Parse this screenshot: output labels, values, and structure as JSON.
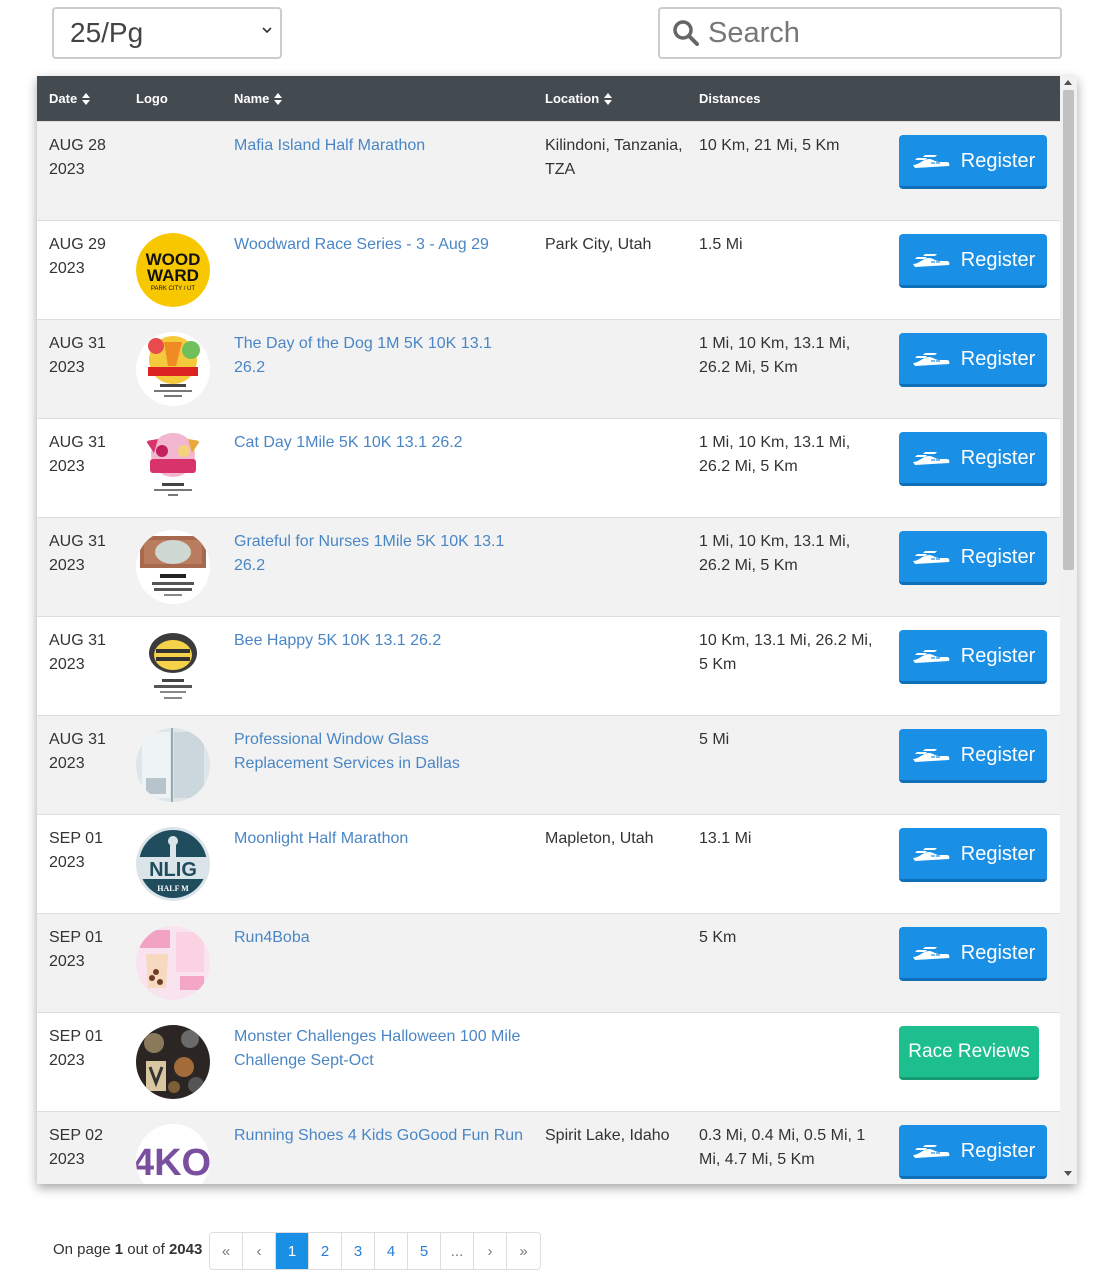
{
  "controls": {
    "per_page": "25/Pg",
    "search_placeholder": "Search"
  },
  "table": {
    "columns": [
      "Date",
      "Logo",
      "Name",
      "Location",
      "Distances"
    ],
    "rows": [
      {
        "date_md": "AUG 28",
        "date_y": "2023",
        "logo": "none",
        "name": "Mafia Island Half Marathon",
        "location": "Kilindoni, Tanzania, TZA",
        "distances": "10 Km, 21 Mi, 5 Km",
        "action": "Register"
      },
      {
        "date_md": "AUG 29",
        "date_y": "2023",
        "logo": "woodward",
        "logo_text_1": "WOOD",
        "logo_text_2": "WARD",
        "logo_text_3": "PARK CITY / UT",
        "name": "Woodward Race Series - 3 - Aug 29",
        "location": "Park City, Utah",
        "distances": "1.5 Mi",
        "action": "Register"
      },
      {
        "date_md": "AUG 31",
        "date_y": "2023",
        "logo": "dog-medal",
        "name": "The Day of the Dog 1M 5K 10K 13.1 26.2",
        "location": "",
        "distances": "1 Mi, 10 Km, 13.1 Mi, 26.2 Mi, 5 Km",
        "action": "Register"
      },
      {
        "date_md": "AUG 31",
        "date_y": "2023",
        "logo": "cat-medal",
        "name": "Cat Day 1Mile 5K 10K 13.1 26.2",
        "location": "",
        "distances": "1 Mi, 10 Km, 13.1 Mi, 26.2 Mi, 5 Km",
        "action": "Register"
      },
      {
        "date_md": "AUG 31",
        "date_y": "2023",
        "logo": "nurses-medal",
        "name": "Grateful for Nurses 1Mile 5K 10K 13.1 26.2",
        "location": "",
        "distances": "1 Mi, 10 Km, 13.1 Mi, 26.2 Mi, 5 Km",
        "action": "Register"
      },
      {
        "date_md": "AUG 31",
        "date_y": "2023",
        "logo": "bee-medal",
        "name": "Bee Happy 5K 10K 13.1 26.2",
        "location": "",
        "distances": "10 Km, 13.1 Mi, 26.2 Mi, 5 Km",
        "action": "Register"
      },
      {
        "date_md": "AUG 31",
        "date_y": "2023",
        "logo": "window-glass",
        "name": "Professional Window Glass Replacement Services in Dallas",
        "location": "",
        "distances": "5 Mi",
        "action": "Register"
      },
      {
        "date_md": "SEP 01",
        "date_y": "2023",
        "logo": "moonlight",
        "logo_text_1": "NLIG",
        "logo_text_2": "HALF M",
        "name": "Moonlight Half Marathon",
        "location": "Mapleton, Utah",
        "distances": "13.1 Mi",
        "action": "Register"
      },
      {
        "date_md": "SEP 01",
        "date_y": "2023",
        "logo": "boba",
        "name": "Run4Boba",
        "location": "",
        "distances": "5 Km",
        "action": "Register"
      },
      {
        "date_md": "SEP 01",
        "date_y": "2023",
        "logo": "monster-medals",
        "name": "Monster Challenges Halloween 100 Mile Challenge Sept-Oct",
        "location": "",
        "distances": "",
        "action": "Race Reviews"
      },
      {
        "date_md": "SEP 02",
        "date_y": "2023",
        "logo": "4ko",
        "logo_text_1": "4KO",
        "name": "Running Shoes 4 Kids GoGood Fun Run",
        "location": "Spirit Lake, Idaho",
        "distances": "0.3 Mi, 0.4 Mi, 0.5 Mi, 1 Mi, 4.7 Mi, 5 Km",
        "action": "Register"
      }
    ]
  },
  "pagination": {
    "prefix": "On page",
    "current": "1",
    "middle": "out of",
    "total": "2043",
    "buttons": [
      "«",
      "‹",
      "1",
      "2",
      "3",
      "4",
      "5",
      "...",
      "›",
      "»"
    ]
  },
  "colors": {
    "header_bg": "#434a50",
    "register": "#1a8fe6",
    "reviews": "#1dbf8f",
    "link": "#4a86c5"
  }
}
